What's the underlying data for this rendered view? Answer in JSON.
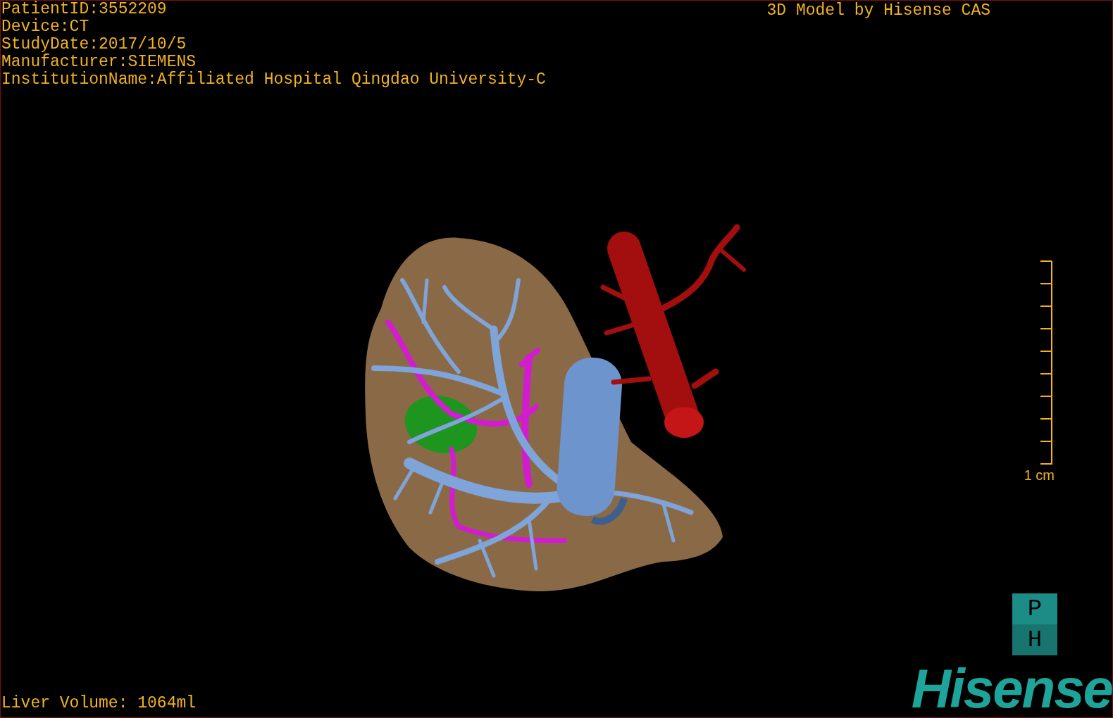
{
  "patient_info": [
    "PatientID:3552209",
    "Device:CT",
    "StudyDate:2017/10/5",
    "Manufacturer:SIEMENS",
    "InstitutionName:Affiliated Hospital Qingdao University-C"
  ],
  "title": "3D Model by Hisense CAS",
  "scale_bar": {
    "label": "1 cm"
  },
  "liver_volume": "Liver Volume: 1064ml",
  "orientation_cube": {
    "faces": [
      "P",
      "H"
    ]
  },
  "logo": "Hisense"
}
